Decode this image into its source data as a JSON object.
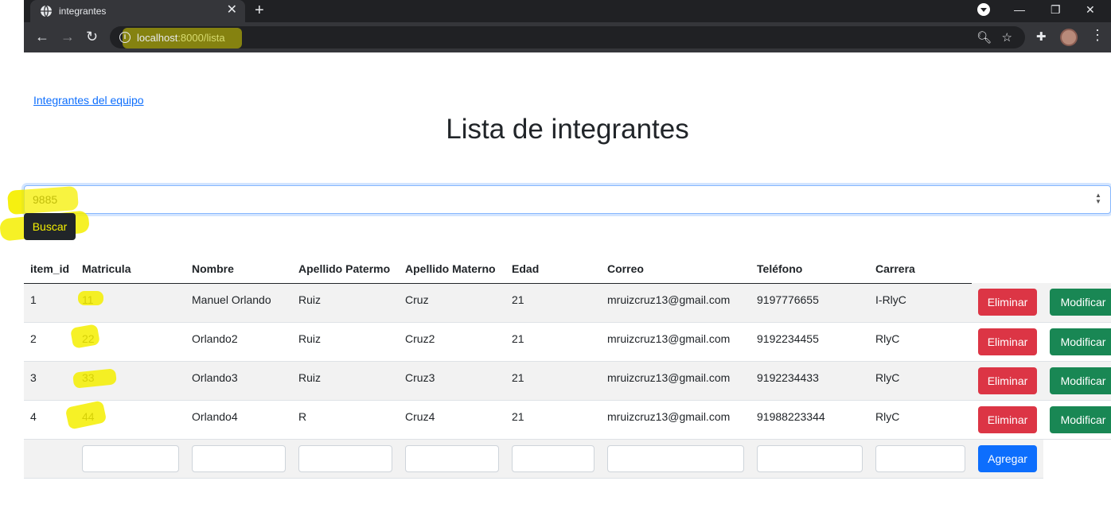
{
  "browser": {
    "tab_title": "integrantes",
    "tab_close": "✕",
    "new_tab": "+",
    "url_host": "localhost",
    "url_path": ":8000/lista"
  },
  "page": {
    "link": "Integrantes del equipo",
    "title": "Lista de integrantes",
    "search_value": "9885",
    "search_button": "Buscar",
    "add_button": "Agregar",
    "delete_button": "Eliminar",
    "edit_button": "Modificar"
  },
  "table": {
    "headers": [
      "item_id",
      "Matricula",
      "Nombre",
      "Apellido Patermo",
      "Apellido Materno",
      "Edad",
      "Correo",
      "Teléfono",
      "Carrera"
    ],
    "rows": [
      [
        "1",
        "11",
        "Manuel Orlando",
        "Ruiz",
        "Cruz",
        "21",
        "mruizcruz13@gmail.com",
        "9197776655",
        "I-RlyC"
      ],
      [
        "2",
        "22",
        "Orlando2",
        "Ruiz",
        "Cruz2",
        "21",
        "mruizcruz13@gmail.com",
        "9192234455",
        "RlyC"
      ],
      [
        "3",
        "33",
        "Orlando3",
        "Ruiz",
        "Cruz3",
        "21",
        "mruizcruz13@gmail.com",
        "9192234433",
        "RlyC"
      ],
      [
        "4",
        "44",
        "Orlando4",
        "R",
        "Cruz4",
        "21",
        "mruizcruz13@gmail.com",
        "91988223344",
        "RlyC"
      ]
    ]
  },
  "colors": {
    "highlight": "#f5ef00",
    "danger": "#dc3545",
    "success": "#198754",
    "primary": "#0d6efd"
  }
}
